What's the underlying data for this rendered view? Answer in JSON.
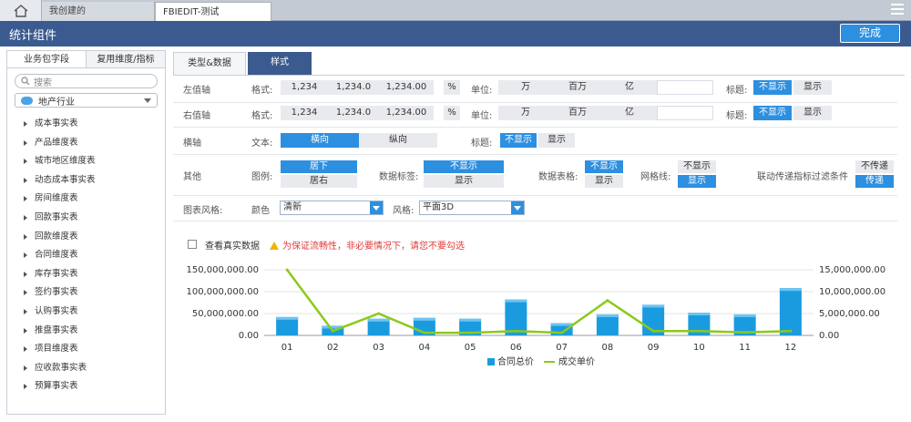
{
  "tabs": {
    "tab1": "我创建的",
    "tab2": "FBIEDIT-测试"
  },
  "header": {
    "title": "统计组件",
    "done": "完成"
  },
  "sidebar": {
    "tabs": [
      "业务包字段",
      "复用维度/指标"
    ],
    "search_placeholder": "搜索",
    "package": "地产行业",
    "items": [
      "成本事实表",
      "产品维度表",
      "城市地区维度表",
      "动态成本事实表",
      "房间维度表",
      "回款事实表",
      "回款维度表",
      "合同维度表",
      "库存事实表",
      "签约事实表",
      "认购事实表",
      "推盘事实表",
      "项目维度表",
      "应收款事实表",
      "预算事实表"
    ]
  },
  "main": {
    "tabs": [
      "类型&数据",
      "样式"
    ],
    "left_axis": {
      "label": "左值轴",
      "format_label": "格式:",
      "formats": [
        "1,234",
        "1,234.0",
        "1,234.00",
        "%"
      ],
      "unit_label": "单位:",
      "units": [
        "万",
        "百万",
        "亿"
      ],
      "title_label": "标题:",
      "title_opts": [
        "不显示",
        "显示"
      ]
    },
    "right_axis": {
      "label": "右值轴",
      "format_label": "格式:",
      "formats": [
        "1,234",
        "1,234.0",
        "1,234.00",
        "%"
      ],
      "unit_label": "单位:",
      "units": [
        "万",
        "百万",
        "亿"
      ],
      "title_label": "标题:",
      "title_opts": [
        "不显示",
        "显示"
      ]
    },
    "h_axis": {
      "label": "横轴",
      "text_label": "文本:",
      "text_opts": [
        "横向",
        "纵向"
      ],
      "title_label": "标题:",
      "title_opts": [
        "不显示",
        "显示"
      ]
    },
    "other": {
      "label": "其他",
      "legend_label": "图例:",
      "legend_opts": [
        "居下",
        "居右"
      ],
      "datalabel_label": "数据标签:",
      "datalabel_opts": [
        "不显示",
        "显示"
      ],
      "datatable_label": "数据表格:",
      "datatable_opts": [
        "不显示",
        "显示"
      ],
      "grid_label": "网格线:",
      "grid_opts": [
        "不显示",
        "显示"
      ],
      "linkage_label": "联动传递指标过滤条件",
      "linkage_opts": [
        "不传递",
        "传递"
      ]
    },
    "style": {
      "label": "图表风格:",
      "color_label": "颜色",
      "color_value": "清新",
      "style_label": "风格:",
      "style_value": "平面3D"
    },
    "real_data_label": "查看真实数据",
    "warning": "为保证流畅性，非必要情况下，请您不要勾选"
  },
  "chart_data": {
    "type": "bar",
    "categories": [
      "01",
      "02",
      "03",
      "04",
      "05",
      "06",
      "07",
      "08",
      "09",
      "10",
      "11",
      "12"
    ],
    "series": [
      {
        "name": "合同总价",
        "type": "bar",
        "axis": "left",
        "values": [
          42000000,
          22000000,
          38000000,
          40000000,
          38000000,
          82000000,
          28000000,
          48000000,
          70000000,
          52000000,
          48000000,
          108000000
        ],
        "color": "#1a9be0"
      },
      {
        "name": "成交单价",
        "type": "line",
        "axis": "right",
        "values": [
          15000000,
          1000000,
          5000000,
          600000,
          600000,
          1000000,
          600000,
          8000000,
          1000000,
          1000000,
          700000,
          1000000
        ],
        "color": "#8cc919"
      }
    ],
    "left_ylim": [
      0,
      150000000
    ],
    "right_ylim": [
      0,
      15000000
    ],
    "left_ticks": [
      "0.00",
      "50,000,000.00",
      "100,000,000.00",
      "150,000,000.00"
    ],
    "right_ticks": [
      "0.00",
      "5,000,000.00",
      "10,000,000.00",
      "15,000,000.00"
    ],
    "legend_position": "bottom"
  }
}
